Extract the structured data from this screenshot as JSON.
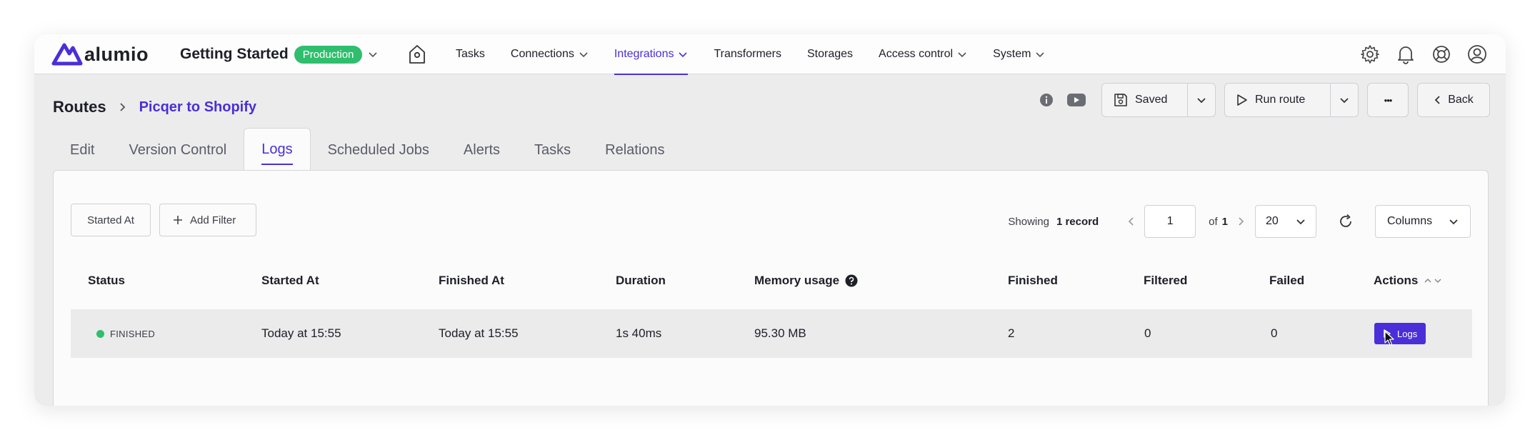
{
  "app": {
    "logo_text": "alumio",
    "project_name": "Getting Started",
    "environment": "Production"
  },
  "nav": {
    "items": [
      {
        "label": "Tasks"
      },
      {
        "label": "Connections"
      },
      {
        "label": "Integrations"
      },
      {
        "label": "Transformers"
      },
      {
        "label": "Storages"
      },
      {
        "label": "Access control"
      },
      {
        "label": "System"
      }
    ]
  },
  "breadcrumb": {
    "root": "Routes",
    "current": "Picqer to Shopify"
  },
  "toolbar": {
    "saved_label": "Saved",
    "run_label": "Run route",
    "more_label": "•••",
    "back_label": "Back"
  },
  "tabs": [
    "Edit",
    "Version Control",
    "Logs",
    "Scheduled Jobs",
    "Alerts",
    "Tasks",
    "Relations"
  ],
  "filters": {
    "started_at": "Started At",
    "add_filter": "Add Filter"
  },
  "pagination": {
    "showing": "Showing",
    "record_count": "1 record",
    "page": "1",
    "of": "of",
    "total_pages": "1",
    "page_size": "20",
    "columns_label": "Columns"
  },
  "table": {
    "headers": {
      "status": "Status",
      "started_at": "Started At",
      "finished_at": "Finished At",
      "duration": "Duration",
      "memory": "Memory usage",
      "finished": "Finished",
      "filtered": "Filtered",
      "failed": "Failed",
      "actions": "Actions"
    },
    "rows": [
      {
        "status": "FINISHED",
        "started_at": "Today at 15:55",
        "finished_at": "Today at 15:55",
        "duration": "1s 40ms",
        "memory": "95.30 MB",
        "finished": "2",
        "filtered": "0",
        "failed": "0",
        "action_label": "Logs"
      }
    ]
  },
  "colors": {
    "accent": "#4a2fd8",
    "success": "#2fbe6e",
    "row_bg": "#ebebec",
    "page_bg": "#ececed"
  }
}
